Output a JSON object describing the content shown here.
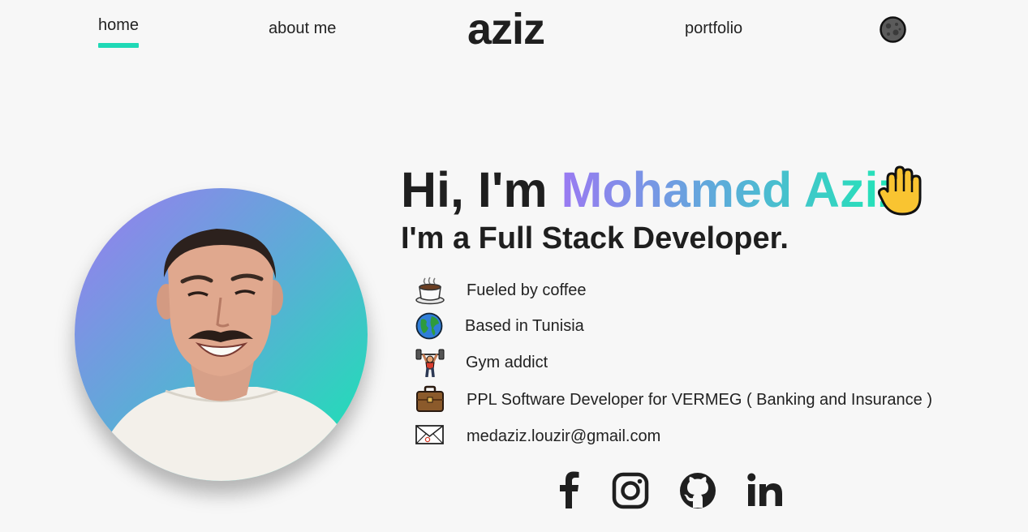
{
  "nav": {
    "home": "home",
    "about": "about me",
    "logo": "aziz",
    "portfolio": "portfolio"
  },
  "hero": {
    "greeting_prefix": "Hi, I'm ",
    "name": "Mohamed Aziz",
    "subtitle": "I'm a Full Stack Developer."
  },
  "facts": [
    {
      "icon": "coffee-icon",
      "text": "Fueled by coffee"
    },
    {
      "icon": "globe-icon",
      "text": "Based in Tunisia"
    },
    {
      "icon": "weightlifter-icon",
      "text": "Gym addict"
    },
    {
      "icon": "briefcase-icon",
      "text": "PPL Software Developer for VERMEG ( Banking and Insurance )"
    },
    {
      "icon": "envelope-icon",
      "text": "medaziz.louzir@gmail.com"
    }
  ],
  "social": [
    "facebook-icon",
    "instagram-icon",
    "github-icon",
    "linkedin-icon"
  ],
  "colors": {
    "accent": "#1fd9b6",
    "gradient_start": "#9b7bf0",
    "gradient_end": "#14e8b0",
    "background": "#f7f7f7"
  }
}
